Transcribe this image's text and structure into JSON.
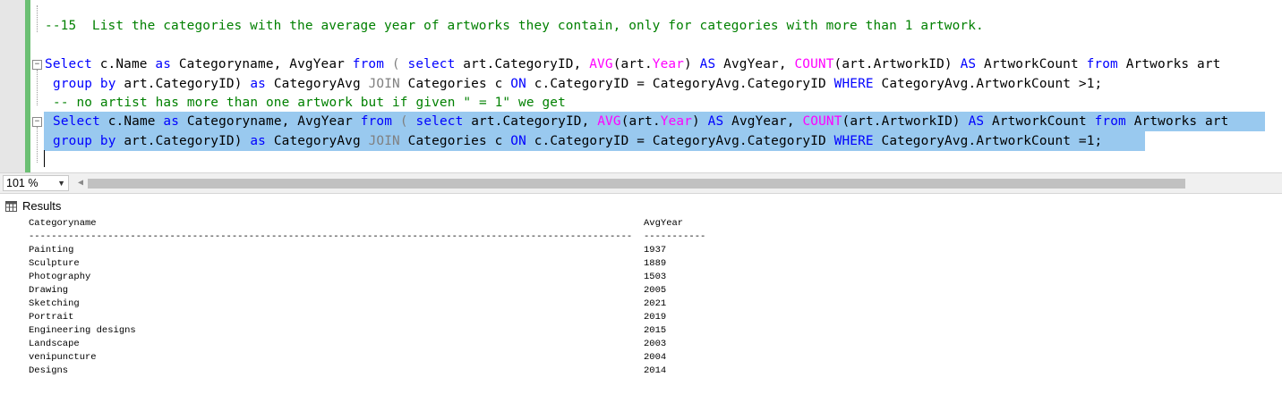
{
  "editor": {
    "comment_line": "--15  List the categories with the average year of artworks they contain, only for categories with more than 1 artwork.",
    "note_line": "-- no artist has more than one artwork but if given \" = 1\" we get",
    "q1_select": "Select",
    "q1_rest_a": " c.Name ",
    "as": "as",
    "categoryname": " Categoryname, AvgYear ",
    "from": "from",
    "paren_open": " ( ",
    "select": "select",
    "art_cat": " art.CategoryID, ",
    "avg": "AVG",
    "art_open": "(art.",
    "year": "Year",
    "close": ") ",
    "AS": "AS",
    "avgyear_comma": " AvgYear, ",
    "count": "COUNT",
    "count_arg": "(art.ArtworkID) ",
    "artworkcount": " ArtworkCount ",
    "artworks_art": " Artworks art",
    "group_by": "group by",
    "grp_arg": " art.CategoryID) ",
    "categoryavg": " CategoryAvg ",
    "join": "JOIN",
    "categories_c": " Categories c ",
    "on": "ON",
    "on_cond": " c.CategoryID = CategoryAvg.CategoryID ",
    "where": "WHERE",
    "where_cond1": " CategoryAvg.ArtworkCount >1;",
    "where_cond2": " CategoryAvg.ArtworkCount =1;"
  },
  "status": {
    "zoom": "101 %",
    "zoom_dropdown": "▼",
    "scroll_left": "◀"
  },
  "results_tab": {
    "label": "Results"
  },
  "results": {
    "columns": [
      "Categoryname",
      "AvgYear"
    ],
    "sep1": "------------------------------------------------------------------------------------------------------------------------",
    "sep2": "-----------",
    "rows": [
      {
        "name": "Painting",
        "year": "1937"
      },
      {
        "name": "Sculpture",
        "year": "1889"
      },
      {
        "name": "Photography",
        "year": "1503"
      },
      {
        "name": "Drawing",
        "year": "2005"
      },
      {
        "name": "Sketching",
        "year": "2021"
      },
      {
        "name": "Portrait",
        "year": "2019"
      },
      {
        "name": "Engineering designs",
        "year": "2015"
      },
      {
        "name": "Landscape",
        "year": "2003"
      },
      {
        "name": "venipuncture",
        "year": "2004"
      },
      {
        "name": "Designs",
        "year": "2014"
      }
    ]
  }
}
